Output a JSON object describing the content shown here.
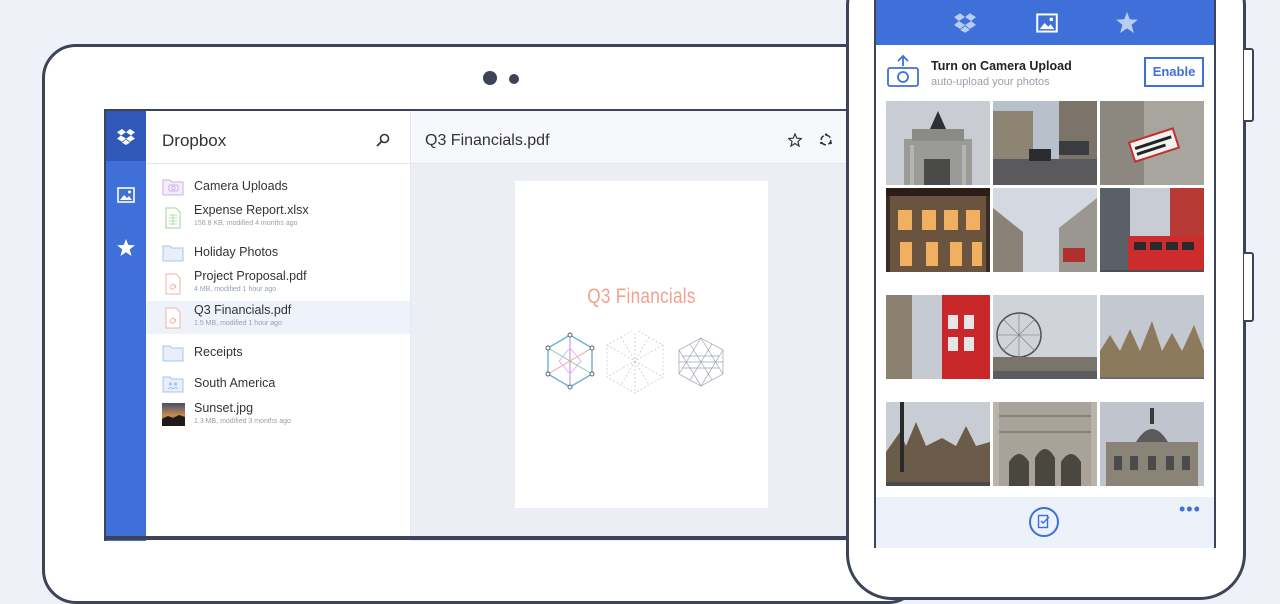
{
  "tablet": {
    "rail": {
      "items": [
        {
          "icon": "dropbox-icon",
          "active": true
        },
        {
          "icon": "photos-icon",
          "active": false
        },
        {
          "icon": "star-icon",
          "active": false
        }
      ]
    },
    "list": {
      "title": "Dropbox",
      "search_icon": "search-icon",
      "files": [
        {
          "name": "Camera Uploads",
          "meta": "",
          "icon": "camera-folder-icon",
          "selected": false
        },
        {
          "name": "Expense Report.xlsx",
          "meta": "156.8 KB, modified 4 months ago",
          "icon": "spreadsheet-icon",
          "selected": false
        },
        {
          "name": "Holiday Photos",
          "meta": "",
          "icon": "folder-icon",
          "selected": false
        },
        {
          "name": "Project Proposal.pdf",
          "meta": "4 MB, modified 1 hour ago",
          "icon": "pdf-icon",
          "selected": false
        },
        {
          "name": "Q3 Financials.pdf",
          "meta": "1.5 MB, modified 1 hour ago",
          "icon": "pdf-icon",
          "selected": true
        },
        {
          "name": "Receipts",
          "meta": "",
          "icon": "folder-icon",
          "selected": false
        },
        {
          "name": "South America",
          "meta": "",
          "icon": "shared-folder-icon",
          "selected": false
        },
        {
          "name": "Sunset.jpg",
          "meta": "1.3 MB, modified 3 months ago",
          "icon": "image-thumbnail",
          "selected": false
        }
      ]
    },
    "document": {
      "title": "Q3 Financials.pdf",
      "actions": [
        "star-icon",
        "share-icon"
      ],
      "page_heading": "Q3 Financials"
    }
  },
  "phone": {
    "tabs": [
      {
        "icon": "dropbox-icon"
      },
      {
        "icon": "photos-icon",
        "active": true
      },
      {
        "icon": "star-icon"
      }
    ],
    "banner": {
      "icon": "camera-upload-icon",
      "title": "Turn on Camera Upload",
      "subtitle": "auto-upload your photos",
      "button": "Enable"
    },
    "photos": [
      "arch-monument",
      "street-traffic",
      "street-sign",
      "building-facade-night",
      "city-street",
      "red-buses",
      "red-phone-box",
      "london-eye",
      "parliament",
      "gothic-church",
      "cathedral-facade",
      "domed-building"
    ],
    "bottom_bar": {
      "action_icon": "select-icon",
      "more_label": "•••"
    }
  },
  "colors": {
    "accent": "#3f6fd8",
    "rail_dark": "#2f58b8",
    "outline": "#3d4458",
    "pdf_heading": "#f2a28b"
  }
}
